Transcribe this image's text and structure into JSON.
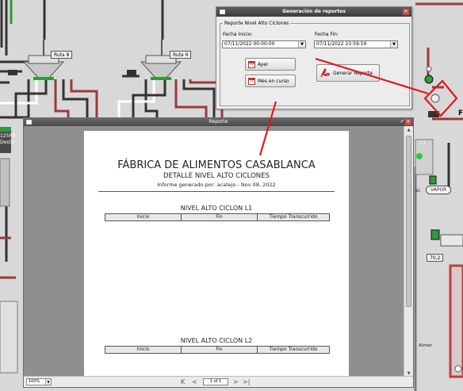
{
  "scada": {
    "route_labels": [
      "Ruta 8",
      "Ruta 9"
    ],
    "left_status": [
      "125R9",
      "Desta"
    ],
    "line_label": "L1",
    "vapor_prefix": "sc",
    "vapor_label": "VAPOR",
    "value_label": "70,2",
    "partial_letter": "F",
    "bottom_label": "Alimen"
  },
  "dialog": {
    "title": "Generación de reportes",
    "group_label": "Reporte Nivel Alto Ciclones",
    "start_label": "Fecha Inicio:",
    "start_value": "07/11/2022 00:00:00",
    "end_label": "Fecha Fin:",
    "end_value": "07/11/2022 23:59:59",
    "yesterday_button": "Ayer",
    "month_button": "Mes en curso",
    "generate_button": "Generar Reporte",
    "close_glyph": "✕"
  },
  "viewer": {
    "title": "Reporte",
    "max_glyph": "↗",
    "close_glyph": "✕",
    "zoom": "100%",
    "page_indicator": "1 of 1",
    "nav": {
      "first": "K",
      "prev": "<",
      "next": ">",
      "last": ">|"
    }
  },
  "report": {
    "company": "FÁBRICA DE ALIMENTOS CASABLANCA",
    "subtitle": "DETALLE NIVEL ALTO CICLONES",
    "generated": "Informe generado por: acatejo - Nov 08, 2022",
    "sections": [
      {
        "title": "NIVEL ALTO CICLON L1",
        "columns": [
          "Inicio",
          "Fin",
          "Tiempo Transcurrido"
        ]
      },
      {
        "title": "NIVEL ALTO CICLON L2",
        "columns": [
          "Inicio",
          "Fin",
          "Tiempo Transcurrido"
        ]
      }
    ]
  },
  "colors": {
    "annotation": "#e5141c",
    "pipe_red": "#9a3a3a",
    "pipe_green": "#2e9a3a"
  }
}
